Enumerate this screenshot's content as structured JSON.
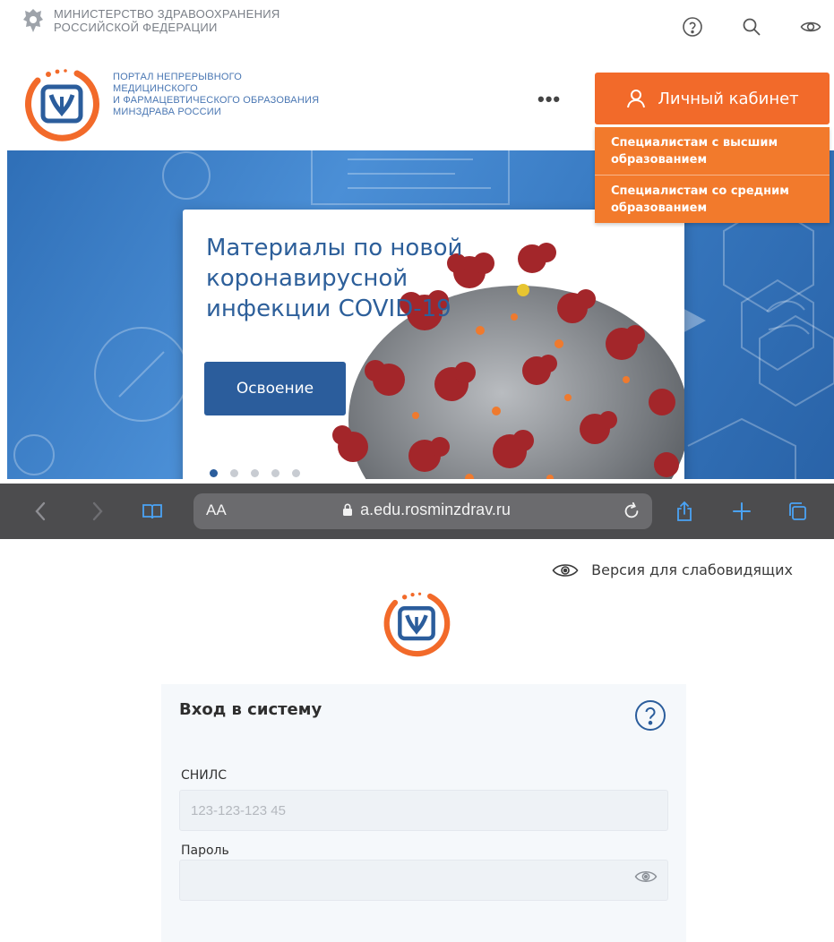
{
  "portal": {
    "ministry_line1": "МИНИСТЕРСТВО ЗДРАВООХРАНЕНИЯ",
    "ministry_line2": "РОССИЙСКОЙ ФЕДЕРАЦИИ",
    "title_lines": [
      "ПОРТАЛ НЕПРЕРЫВНОГО",
      "МЕДИЦИНСКОГО",
      "И ФАРМАЦЕВТИЧЕСКОГО ОБРАЗОВАНИЯ",
      "МИНЗДРАВА РОССИИ"
    ],
    "more_label": "•••",
    "cabinet_button": "Личный кабинет",
    "cabinet_menu": [
      "Специалистам с высшим образованием",
      "Специалистам со средним образованием"
    ],
    "hero": {
      "heading_lines": [
        "Материалы по новой",
        "коронавирусной",
        "инфекции COVID-19"
      ],
      "button": "Освоение",
      "slides_total": 5,
      "slide_active": 1
    },
    "colors": {
      "accent_orange": "#f26a2a",
      "brand_blue": "#2b5d9c",
      "hero_blue": "#3a7cc4"
    },
    "icons": [
      "help-icon",
      "search-icon",
      "eye-icon"
    ]
  },
  "browser": {
    "text_size": "AA",
    "url": "a.edu.rosminzdrav.ru",
    "icons": [
      "back-icon",
      "forward-icon",
      "bookmarks-icon",
      "lock-icon",
      "reload-icon",
      "share-icon",
      "new-tab-icon",
      "tabs-icon"
    ]
  },
  "login": {
    "low_vision_link": "Версия для слабовидящих",
    "title": "Вход в систему",
    "snils_label": "СНИЛС",
    "snils_placeholder": "123-123-123 45",
    "snils_value": "",
    "password_label": "Пароль",
    "password_value": ""
  }
}
